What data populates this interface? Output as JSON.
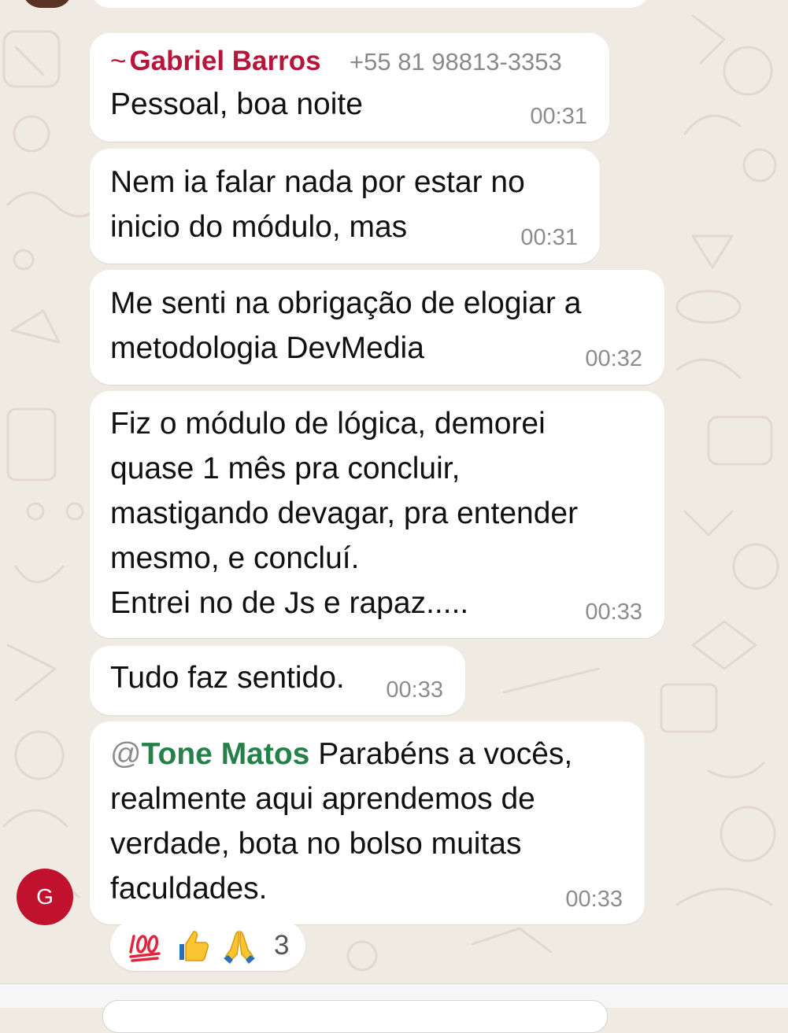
{
  "chat": {
    "messages": [
      {
        "sender": "Gabriel Barros",
        "sender_prefix": "~",
        "phone": "+55 81 98813-3353",
        "lines": [
          "Pessoal, boa noite"
        ],
        "time": "00:31"
      },
      {
        "lines": [
          "Nem ia falar nada por estar no",
          "inicio do módulo, mas"
        ],
        "time": "00:31"
      },
      {
        "lines": [
          "Me senti na obrigação de elogiar a",
          "metodologia DevMedia"
        ],
        "time": "00:32"
      },
      {
        "lines": [
          "Fiz o módulo de lógica, demorei",
          "quase 1 mês pra concluir,",
          "mastigando devagar, pra entender",
          "mesmo, e concluí.",
          "Entrei no de Js e rapaz....."
        ],
        "time": "00:33"
      },
      {
        "lines": [
          "Tudo faz sentido."
        ],
        "time": "00:33"
      },
      {
        "mention_at": "@",
        "mention_name": "Tone Matos",
        "lines": [
          " Parabéns a vocês,",
          "realmente aqui aprendemos de",
          "verdade, bota no bolso muitas",
          "faculdades."
        ],
        "time": "00:33"
      }
    ],
    "avatar_initial": "G",
    "avatar_color": "#c0112e",
    "sender_color": "#b7163a",
    "mention_color": "#25804a",
    "background_color": "#efeae2",
    "reactions": {
      "icons": [
        "hundred-points",
        "thumbs-up",
        "folded-hands"
      ],
      "count": "3"
    }
  }
}
